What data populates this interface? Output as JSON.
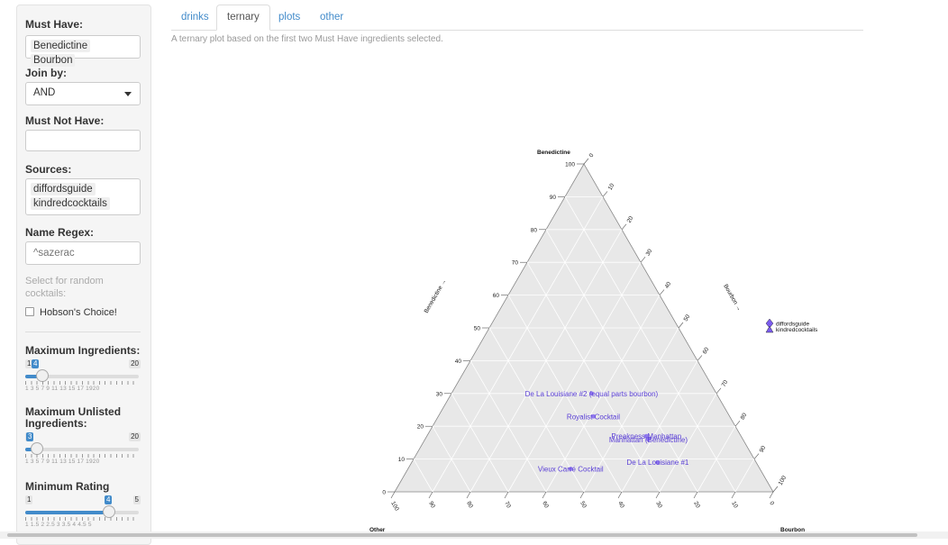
{
  "sidebar": {
    "must_have": {
      "label": "Must Have:",
      "chips": [
        "Benedictine",
        "Bourbon"
      ]
    },
    "join_by": {
      "label": "Join by:",
      "value": "AND"
    },
    "must_not_have": {
      "label": "Must Not Have:",
      "value": ""
    },
    "sources": {
      "label": "Sources:",
      "chips": [
        "diffordsguide",
        "kindredcocktails"
      ]
    },
    "name_regex": {
      "label": "Name Regex:",
      "placeholder": "^sazerac"
    },
    "random": {
      "label": "Select for random cocktails:",
      "checkbox_label": "Hobson's Choice!",
      "checked": false
    },
    "max_ingredients": {
      "label": "Maximum Ingredients:",
      "min": "1",
      "max": "20",
      "value": 4,
      "ticks": "1   3   5   7   9  11  13  15  17  1920"
    },
    "max_unlisted": {
      "label": "Maximum Unlisted Ingredients:",
      "min": "1",
      "max": "20",
      "value": 3,
      "ticks": "1   3   5   7   9  11  13  15  17  1920"
    },
    "min_rating": {
      "label": "Minimum Rating",
      "min": "1",
      "max": "5",
      "value": 4,
      "ticks": "1    1.5    2    2.5    3    3.5    4    4.5    5"
    }
  },
  "tabs": [
    {
      "label": "drinks",
      "active": false
    },
    {
      "label": "ternary",
      "active": true
    },
    {
      "label": "plots",
      "active": false
    },
    {
      "label": "other",
      "active": false
    }
  ],
  "description": "A ternary plot based on the first two Must Have ingredients selected.",
  "chart_data": {
    "type": "scatter",
    "subtype": "ternary",
    "axes": {
      "top": "Benedictine",
      "left": "Other",
      "right": "Bourbon",
      "left_side_label": "Benedictine →",
      "right_side_label": "Bourbon →"
    },
    "ticks": [
      "0",
      "10",
      "20",
      "30",
      "40",
      "50",
      "60",
      "70",
      "80",
      "90",
      "100"
    ],
    "grid": true,
    "legend": {
      "placement": "right",
      "entries": [
        {
          "name": "diffordsguide",
          "marker": "diamond"
        },
        {
          "name": "kindredcocktails",
          "marker": "triangle"
        }
      ]
    },
    "colors": {
      "points": "#7b5cf0",
      "labels": "#5a3fd6",
      "panel": "#e8e8e8"
    },
    "points": [
      {
        "label": "De La Louisiane #2 (equal parts bourbon)",
        "benedictine": 30,
        "bourbon": 37
      },
      {
        "label": "Royalist Cocktail",
        "benedictine": 23,
        "bourbon": 41
      },
      {
        "label": "Preakness Manhattan",
        "benedictine": 17,
        "bourbon": 58
      },
      {
        "label": "Manhattan (Bénédictine)",
        "benedictine": 16,
        "bourbon": 59
      },
      {
        "label": "Vieux Carré Cocktail",
        "benedictine": 7,
        "bourbon": 43
      },
      {
        "label": "De La Louisiane #1",
        "benedictine": 9,
        "bourbon": 65
      }
    ]
  }
}
